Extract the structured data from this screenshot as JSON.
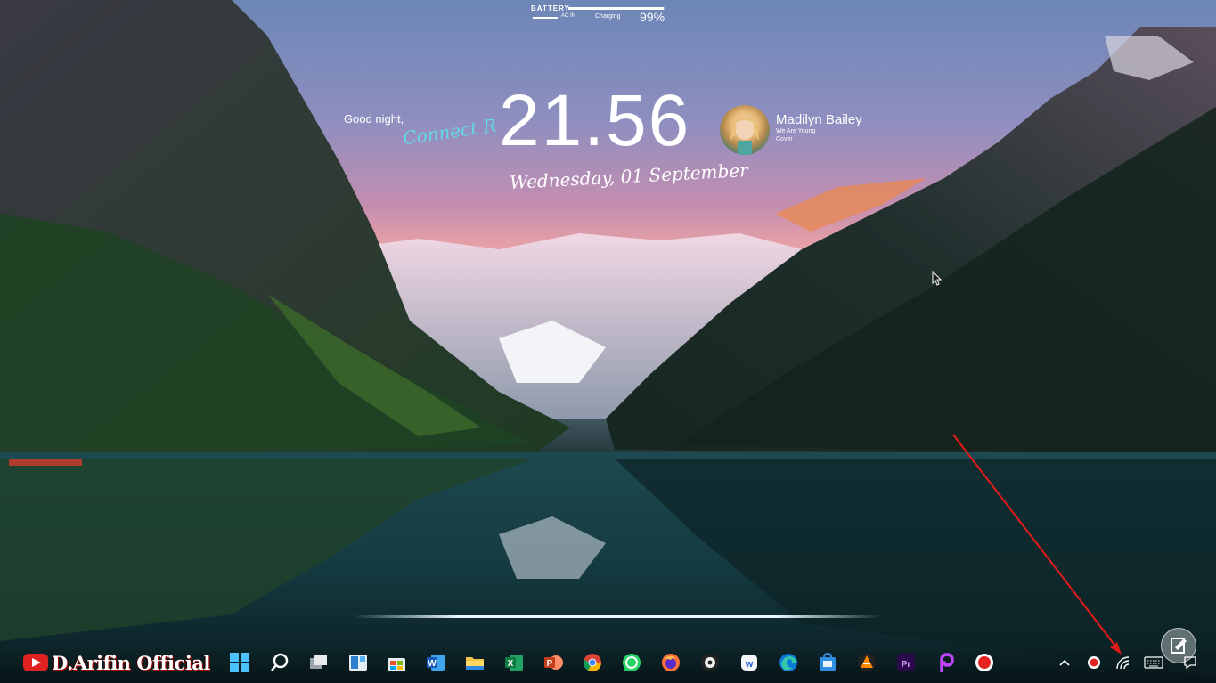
{
  "battery": {
    "title": "BATTERY",
    "ac": "AC IN",
    "status": "Charging",
    "percent": "99%",
    "level": 0.99
  },
  "greeting": {
    "text": "Good night,",
    "user": "Connect R"
  },
  "clock": {
    "time": "21.56",
    "date": "Wednesday, 01 September"
  },
  "music": {
    "artist": "Madilyn Bailey",
    "title": "We Are Young",
    "subtitle": "Cover"
  },
  "watermark": {
    "text": "D.Arifin Official"
  },
  "taskbar": {
    "apps": [
      "windows-start-icon",
      "search-icon",
      "task-view-icon",
      "widgets-icon",
      "microsoft-store-icon",
      "word-icon",
      "file-explorer-icon",
      "excel-icon",
      "powerpoint-icon",
      "chrome-icon",
      "whatsapp-icon",
      "firefox-icon",
      "media-player-icon",
      "xd-browser-icon",
      "edge-icon",
      "store-bag-icon",
      "vlc-icon",
      "premiere-icon",
      "picsart-icon",
      "record-icon"
    ],
    "tray": [
      "chevron-up-icon",
      "record-tray-icon",
      "wifi-icon",
      "keyboard-icon",
      "notification-icon"
    ]
  },
  "colors": {
    "accent": "#64d9e6",
    "arrow": "#e51b1b"
  }
}
